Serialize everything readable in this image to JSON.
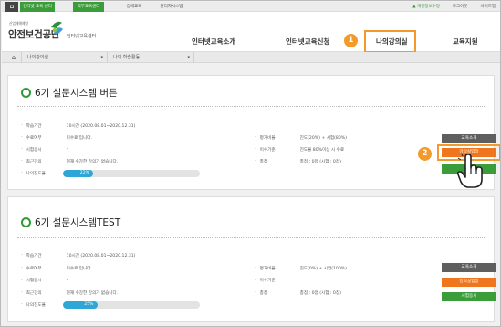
{
  "topbar": {
    "home_icon": "home-icon",
    "tabs": [
      {
        "label": "인터넷 교육 센터",
        "style": "active"
      },
      {
        "label": "직무교육센터",
        "style": "active"
      },
      {
        "label": "집체교육",
        "style": "dark"
      },
      {
        "label": "관리자시스템",
        "style": "dark"
      }
    ],
    "links": {
      "user": "▲ 개인정보수정",
      "logout": "로그아웃",
      "sitemap": "사이트맵"
    }
  },
  "header": {
    "logo_small": "산업재해예방",
    "logo_main": "안전보건공단",
    "logo_sub": "인터넷교육센터",
    "nav": [
      "인터넷교육소개",
      "인터넷교육신청",
      "나의강의실",
      "교육지원"
    ]
  },
  "callouts": {
    "one": "1",
    "two": "2"
  },
  "breadcrumb": [
    "나의강의실",
    "나의 학습활동"
  ],
  "courses": [
    {
      "title": "6기 설문시스템 버튼",
      "fields_left": [
        {
          "label": "학습기간",
          "value": "10시간 (2020.08.01~2020.12.31)"
        },
        {
          "label": "수료여부",
          "value": "미수료 입니다."
        },
        {
          "label": "시험응시",
          "value": "-"
        },
        {
          "label": "최근강의",
          "value": "현재 수강한 강의가 없습니다."
        },
        {
          "label": "나의진도율",
          "value": ""
        }
      ],
      "fields_right": [
        {
          "label": "평가비율",
          "value": "진도(20%) + 시험(80%)"
        },
        {
          "label": "이수기준",
          "value": "진도율 80%이상 시 수료"
        },
        {
          "label": "총점",
          "value": "총점 : 0점 (시험 : 0점)"
        }
      ],
      "progress": 22,
      "progress_label": "22%",
      "buttons": [
        "교육소개",
        "강의실입장"
      ]
    },
    {
      "title": "6기 설문시스템TEST",
      "fields_left": [
        {
          "label": "학습기간",
          "value": "10시간 (2020.08.01~2020.12.31)"
        },
        {
          "label": "수료여부",
          "value": "미수료 입니다."
        },
        {
          "label": "시험응시",
          "value": "-"
        },
        {
          "label": "최근강의",
          "value": "현재 수강한 강의가 없습니다."
        },
        {
          "label": "나의진도율",
          "value": ""
        }
      ],
      "fields_right": [
        {
          "label": "평가비율",
          "value": "진도(0%) + 시험(100%)"
        },
        {
          "label": "이수기준",
          "value": "-"
        },
        {
          "label": "총점",
          "value": "총점 : 0점 (시험 : 0점)"
        }
      ],
      "progress": 25,
      "progress_label": "25%",
      "buttons": [
        "교육소개",
        "강의실입장",
        "시험응시"
      ]
    }
  ],
  "colors": {
    "green": "#3a9d3a",
    "orange": "#f0761e",
    "callout": "#f39a2b",
    "progress": "#2ea7d6"
  }
}
